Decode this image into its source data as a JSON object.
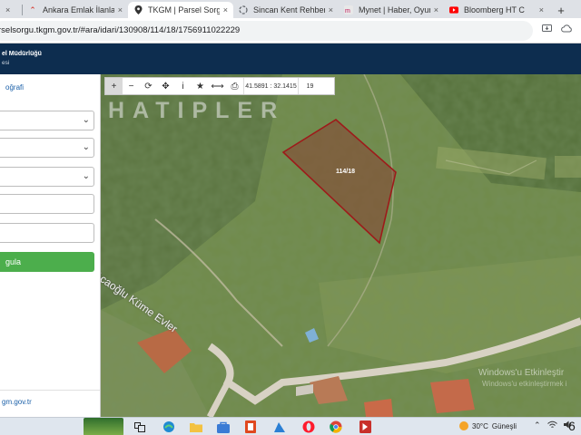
{
  "browser": {
    "tabs": [
      {
        "title": "",
        "icon": "page-icon",
        "active": false
      },
      {
        "title": "Ankara Emlak İlanları",
        "icon": "brand-logo-icon",
        "active": false
      },
      {
        "title": "TKGM | Parsel Sorgu",
        "icon": "location-pin-icon",
        "active": true
      },
      {
        "title": "Sincan Kent Rehberi",
        "icon": "loading-icon",
        "active": false
      },
      {
        "title": "Mynet | Haber, Oyun",
        "icon": "mynet-logo-icon",
        "active": false
      },
      {
        "title": "Bloomberg HT C",
        "icon": "youtube-icon",
        "active": false
      }
    ],
    "new_tab": "+",
    "close": "×",
    "url": "rselsorgu.tkgm.gov.tr/#ara/idari/130908/114/18/1756911022229"
  },
  "site_header": {
    "title_fragment": "el Müdürlüğü",
    "subtitle_fragment": "esi"
  },
  "left_panel": {
    "heading": "oğrafi",
    "selects": [
      "",
      "",
      ""
    ],
    "inputs": [
      "",
      ""
    ],
    "button_label": "gula",
    "footer": "gm.gov.tr"
  },
  "map": {
    "toolbar": {
      "buttons": [
        "+",
        "−",
        "⟳",
        "✥",
        "i",
        "★",
        "⟷",
        "⎙"
      ],
      "coordinates": "41.5891 : 32.1415",
      "zoom": "19"
    },
    "place_label": "HATIPLER",
    "road_label": "Acaoğlu Küme Evler",
    "parcel_label": "114/18",
    "parcel_outline_color": "#9e1a1a",
    "watermark_line1": "Windows'u Etkinleştir",
    "watermark_line2": "Windows'u etkinleştirmek i"
  },
  "taskbar": {
    "weather_temp": "30°C",
    "weather_text": "Güneşli",
    "clock": "6"
  }
}
